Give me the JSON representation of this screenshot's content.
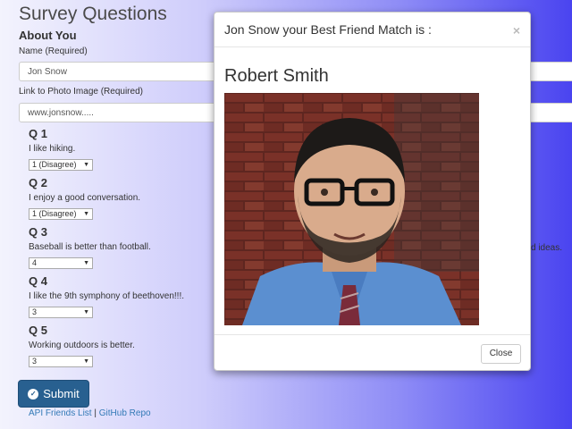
{
  "survey": {
    "title": "Survey Questions",
    "about_heading": "About You",
    "name_label": "Name (Required)",
    "name_value": "Jon Snow",
    "photo_label": "Link to Photo Image (Required)",
    "photo_value": "www.jonsnow.....",
    "questions": [
      {
        "title": "Q 1",
        "text": "I like hiking.",
        "selected": "1 (Disagree)"
      },
      {
        "title": "Q 2",
        "text": "I enjoy a good conversation.",
        "selected": "1 (Disagree)"
      },
      {
        "title": "Q 3",
        "text": "Baseball is better than football.",
        "selected": "4"
      },
      {
        "title": "Q 4",
        "text": "I like the 9th symphony of beethoven!!!.",
        "selected": "3"
      },
      {
        "title": "Q 5",
        "text": "Working outdoors is better.",
        "selected": "3"
      }
    ],
    "submit_label": "Submit",
    "partial_text_behind_modal": "d ideas."
  },
  "footer": {
    "api_link": "API Friends List",
    "separator": "|",
    "github_link": "GitHub Repo"
  },
  "modal": {
    "title": "Jon Snow your Best Friend Match is :",
    "close_x": "×",
    "match_name": "Robert Smith",
    "close_label": "Close"
  },
  "icons": {
    "submit_icon": "check-circle-icon",
    "select_arrow": "caret-down-icon",
    "modal_close": "close-icon"
  },
  "colors": {
    "primary_button": "#286090",
    "link": "#337ab7",
    "background_gradient_end": "#4a44f0"
  }
}
